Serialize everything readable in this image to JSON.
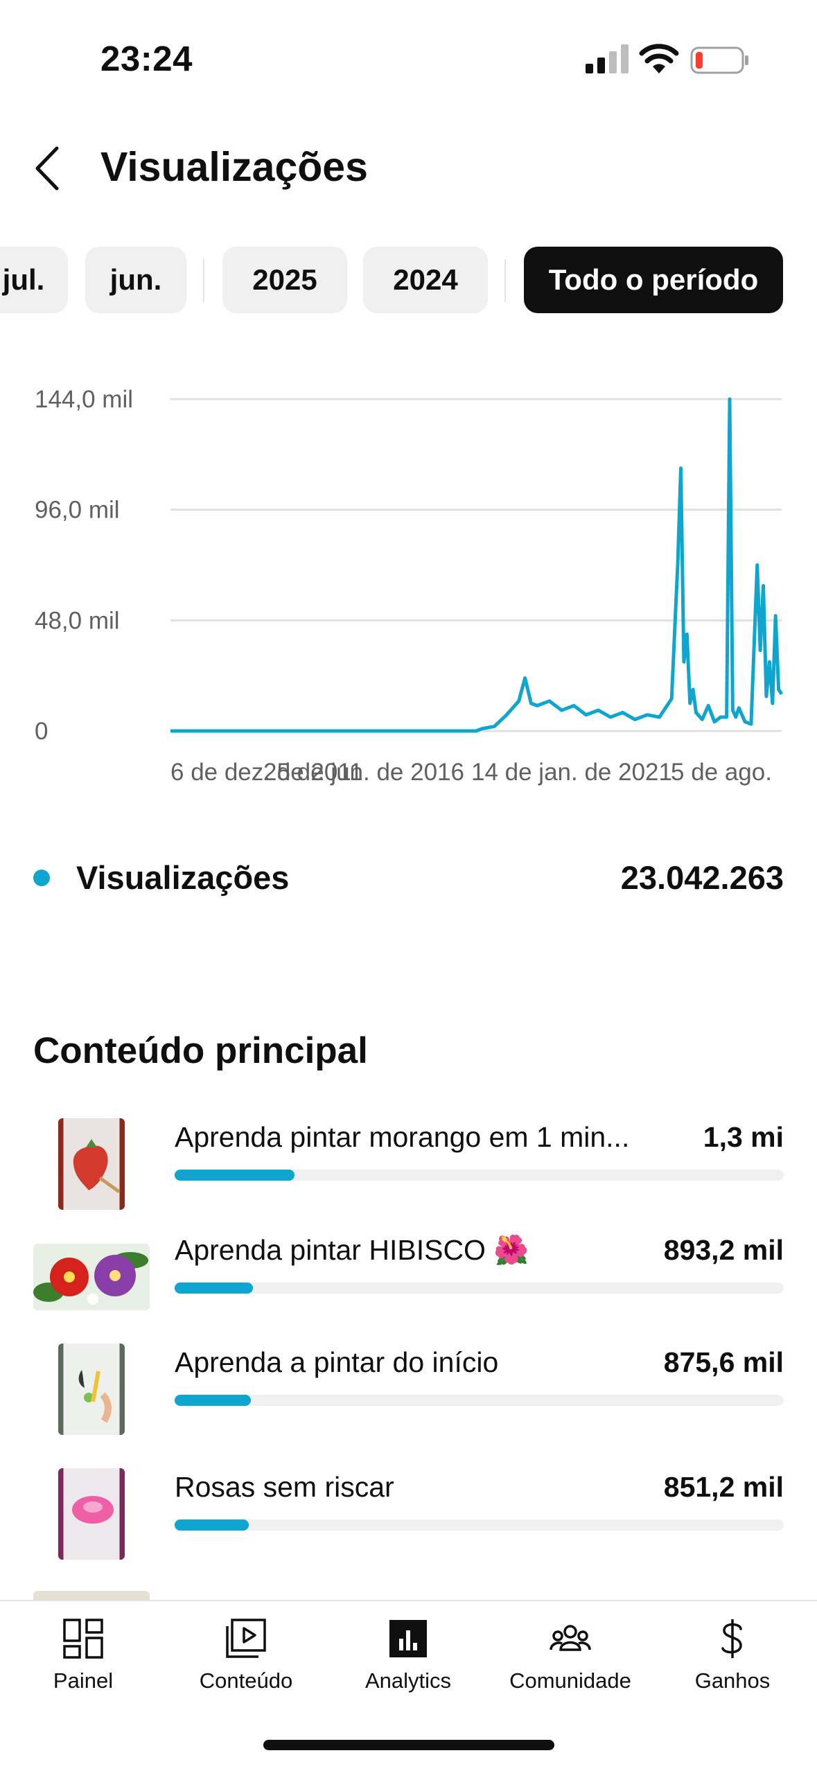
{
  "status_bar": {
    "time": "23:24",
    "icons": [
      "signal-icon",
      "wifi-icon",
      "battery-icon"
    ],
    "battery_color": "#ff3b30"
  },
  "header": {
    "back_icon": "chevron-left-icon",
    "title": "Visualizações"
  },
  "filters": {
    "chips": [
      {
        "label": "jul.",
        "active": false
      },
      {
        "label": "jun.",
        "active": false
      },
      {
        "label": "2025",
        "active": false
      },
      {
        "label": "2024",
        "active": false
      },
      {
        "label": "Todo o período",
        "active": true
      }
    ]
  },
  "chart_data": {
    "type": "line",
    "ylim": [
      0,
      144000
    ],
    "y_ticks": [
      "144,0 mil",
      "96,0 mil",
      "48,0 mil",
      "0"
    ],
    "x_ticks": [
      "6 de dez. de 2011",
      "25 de jun. de 2016",
      "14 de jan. de 2021",
      "5 de ago."
    ],
    "grid": true,
    "color": "#0ea5cf",
    "series": [
      {
        "name": "Visualizações",
        "x": [
          0,
          0.3,
          0.5,
          0.51,
          0.53,
          0.55,
          0.57,
          0.58,
          0.59,
          0.6,
          0.62,
          0.64,
          0.66,
          0.68,
          0.7,
          0.72,
          0.74,
          0.76,
          0.78,
          0.8,
          0.82,
          0.83,
          0.835,
          0.84,
          0.845,
          0.85,
          0.855,
          0.86,
          0.87,
          0.88,
          0.89,
          0.9,
          0.91,
          0.915,
          0.92,
          0.925,
          0.93,
          0.94,
          0.95,
          0.96,
          0.965,
          0.97,
          0.975,
          0.98,
          0.985,
          0.99,
          0.995,
          1.0
        ],
        "y": [
          0,
          0,
          0,
          1000,
          2000,
          7000,
          13000,
          23000,
          12000,
          11000,
          13000,
          9000,
          11000,
          7000,
          9000,
          6000,
          8000,
          5000,
          7000,
          6000,
          14000,
          73000,
          114000,
          30000,
          42000,
          12000,
          18000,
          8000,
          5000,
          11000,
          4000,
          6000,
          6000,
          144000,
          9000,
          6000,
          10000,
          4000,
          3000,
          72000,
          35000,
          63000,
          15000,
          30000,
          12000,
          50000,
          18000,
          16000
        ]
      }
    ]
  },
  "legend": {
    "label": "Visualizações",
    "value": "23.042.263"
  },
  "content": {
    "section_title": "Conteúdo principal",
    "items": [
      {
        "title": "Aprenda pintar morango em 1 min...",
        "value": "1,3 mi",
        "share": 0.197
      },
      {
        "title": "Aprenda pintar HIBISCO 🌺",
        "value": "893,2 mil",
        "share": 0.128
      },
      {
        "title": "Aprenda a pintar do início",
        "value": "875,6 mil",
        "share": 0.125
      },
      {
        "title": "Rosas sem riscar",
        "value": "851,2 mil",
        "share": 0.122
      }
    ]
  },
  "bottom_nav": {
    "items": [
      {
        "label": "Painel",
        "icon": "dashboard-icon"
      },
      {
        "label": "Conteúdo",
        "icon": "content-icon"
      },
      {
        "label": "Analytics",
        "icon": "analytics-icon"
      },
      {
        "label": "Comunidade",
        "icon": "community-icon"
      },
      {
        "label": "Ganhos",
        "icon": "dollar-icon"
      }
    ]
  }
}
